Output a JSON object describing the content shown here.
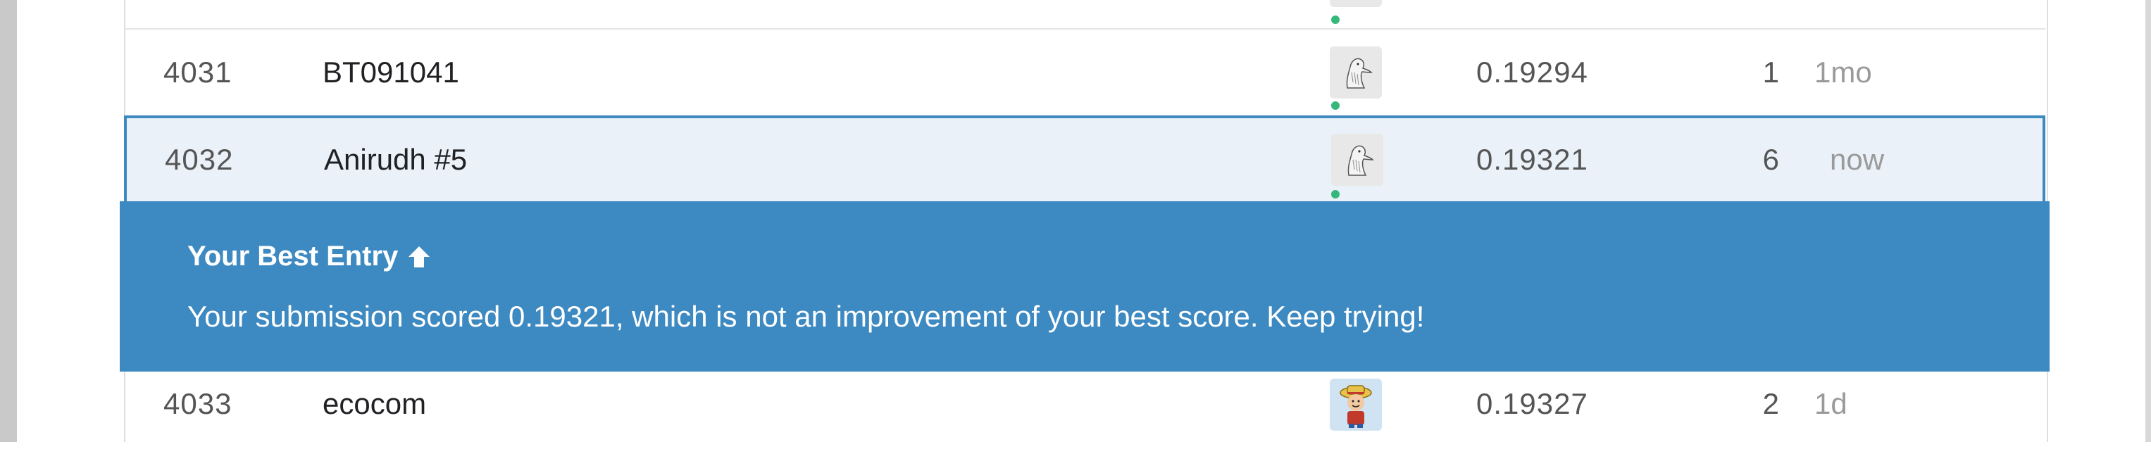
{
  "leaderboard": {
    "rows": [
      {
        "rank": "4031",
        "team": "BT091041",
        "score": "0.19294",
        "entries": "1",
        "last": "1mo",
        "avatar": "bird-avatar"
      },
      {
        "rank": "4032",
        "team": "Anirudh #5",
        "score": "0.19321",
        "entries": "6",
        "last": "now",
        "avatar": "bird-avatar"
      },
      {
        "rank": "4033",
        "team": "ecocom",
        "score": "0.19327",
        "entries": "2",
        "last": "1d",
        "avatar": "cartoon-avatar"
      }
    ]
  },
  "banner": {
    "title": "Your Best Entry",
    "icon": "arrow-up-icon",
    "message": "Your submission scored 0.19321, which is not an improvement of your best score. Keep trying!",
    "color": "#3d89c1"
  },
  "colors": {
    "highlight_row_bg": "#eaf1f8",
    "highlight_border": "#3d89c1",
    "online": "#35b87a"
  }
}
